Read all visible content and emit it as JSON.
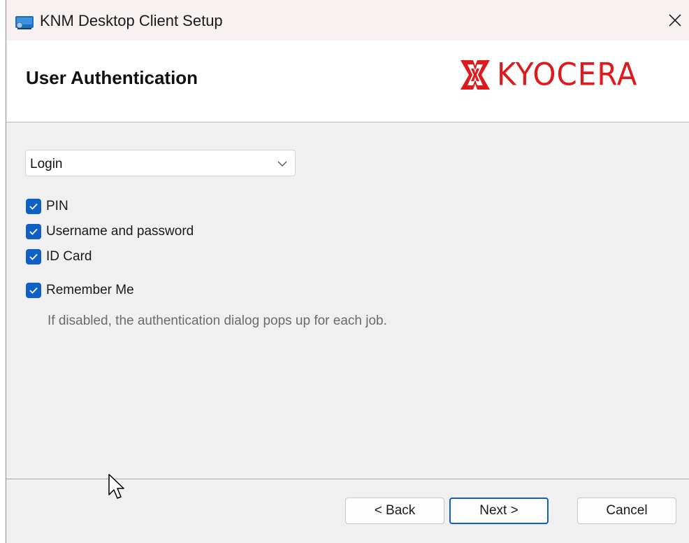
{
  "window": {
    "title": "KNM Desktop Client Setup",
    "icons": {
      "app": "installer-app-icon",
      "close": "close-icon"
    }
  },
  "header": {
    "title": "User Authentication",
    "logo_text": "KYOCERA",
    "logo_color": "#e0191c"
  },
  "auth_mode": {
    "selected": "Login",
    "icon": "chevron-down-icon"
  },
  "methods": [
    {
      "label": "PIN",
      "checked": true
    },
    {
      "label": "Username and password",
      "checked": true
    },
    {
      "label": "ID Card",
      "checked": true
    }
  ],
  "remember_me": {
    "label": "Remember Me",
    "checked": true,
    "hint": "If disabled, the authentication dialog pops up for each job."
  },
  "buttons": {
    "back": "< Back",
    "next": "Next >",
    "cancel": "Cancel"
  },
  "colors": {
    "accent": "#0f5fc7",
    "window_bg": "#f0f0f0",
    "titlebar_bg": "#f7f1f1"
  }
}
